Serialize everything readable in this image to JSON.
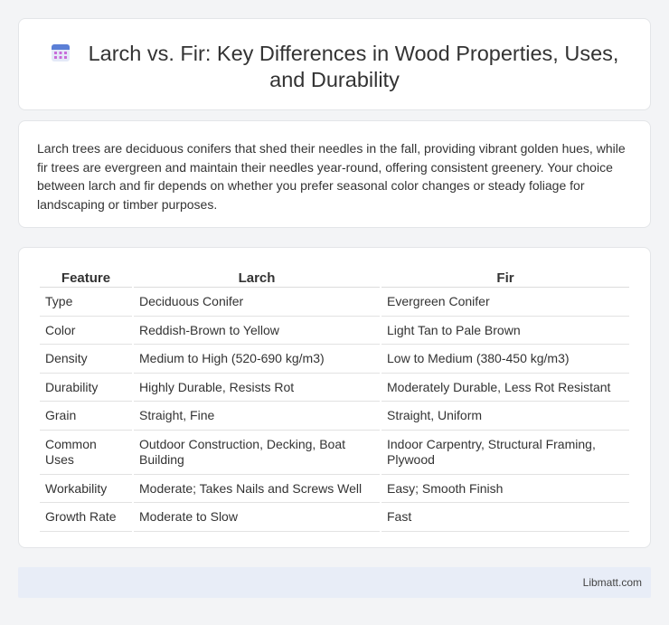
{
  "header": {
    "title_line1": "Larch vs. Fir: Key Differences in Wood Properties, Uses,",
    "title_line2": "and Durability",
    "icon": "calendar-icon"
  },
  "intro": {
    "text": "Larch trees are deciduous conifers that shed their needles in the fall, providing vibrant golden hues, while fir trees are evergreen and maintain their needles year-round, offering consistent greenery. Your choice between larch and fir depends on whether you prefer seasonal color changes or steady foliage for landscaping or timber purposes."
  },
  "table": {
    "headers": [
      "Feature",
      "Larch",
      "Fir"
    ],
    "rows": [
      [
        "Type",
        "Deciduous Conifer",
        "Evergreen Conifer"
      ],
      [
        "Color",
        "Reddish-Brown to Yellow",
        "Light Tan to Pale Brown"
      ],
      [
        "Density",
        "Medium to High (520-690 kg/m3)",
        "Low to Medium (380-450 kg/m3)"
      ],
      [
        "Durability",
        "Highly Durable, Resists Rot",
        "Moderately Durable, Less Rot Resistant"
      ],
      [
        "Grain",
        "Straight, Fine",
        "Straight, Uniform"
      ],
      [
        "Common Uses",
        "Outdoor Construction, Decking, Boat Building",
        "Indoor Carpentry, Structural Framing, Plywood"
      ],
      [
        "Workability",
        "Moderate; Takes Nails and Screws Well",
        "Easy; Smooth Finish"
      ],
      [
        "Growth Rate",
        "Moderate to Slow",
        "Fast"
      ]
    ]
  },
  "footer": {
    "brand": "Libmatt.com"
  }
}
